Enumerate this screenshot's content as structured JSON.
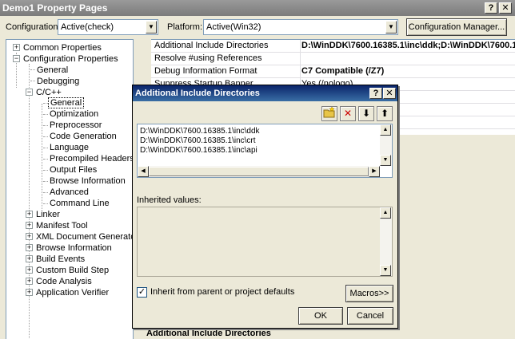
{
  "window": {
    "title": "Demo1 Property Pages",
    "help_glyph": "?",
    "close_glyph": "✕"
  },
  "toolbar": {
    "configuration_label": "Configuration:",
    "configuration_value": "Active(check)",
    "platform_label": "Platform:",
    "platform_value": "Active(Win32)",
    "config_manager_label": "Configuration Manager..."
  },
  "tree": {
    "common_properties": "Common Properties",
    "configuration_properties": "Configuration Properties",
    "general": "General",
    "debugging": "Debugging",
    "cpp": "C/C++",
    "cpp_children": [
      "General",
      "Optimization",
      "Preprocessor",
      "Code Generation",
      "Language",
      "Precompiled Headers",
      "Output Files",
      "Browse Information",
      "Advanced",
      "Command Line"
    ],
    "after_items": [
      "Linker",
      "Manifest Tool",
      "XML Document Generator",
      "Browse Information",
      "Build Events",
      "Custom Build Step",
      "Code Analysis",
      "Application Verifier"
    ]
  },
  "grid": {
    "rows": [
      {
        "name": "Additional Include Directories",
        "value": "D:\\WinDDK\\7600.16385.1\\inc\\ddk;D:\\WinDDK\\7600.1"
      },
      {
        "name": "Resolve #using References",
        "value": ""
      },
      {
        "name": "Debug Information Format",
        "value": "C7 Compatible (/Z7)"
      },
      {
        "name": "Suppress Startup Banner",
        "value": "Yes (/nologo)"
      }
    ],
    "bottom_label": "Additional Include Directories"
  },
  "dialog": {
    "title": "Additional Include Directories",
    "help_glyph": "?",
    "close_glyph": "✕",
    "directories": [
      "D:\\WinDDK\\7600.16385.1\\inc\\ddk",
      "D:\\WinDDK\\7600.16385.1\\inc\\crt",
      "D:\\WinDDK\\7600.16385.1\\inc\\api"
    ],
    "inherited_label": "Inherited values:",
    "inherit_checkbox_label": "Inherit from parent or project defaults",
    "inherit_checked": true,
    "macros_label": "Macros>>",
    "ok_label": "OK",
    "cancel_label": "Cancel"
  },
  "colors": {
    "dialog_title_bg": "#0a246a",
    "main_title_bg": "#7b7b7b",
    "face": "#ece9d8",
    "delete_red": "#cc0000"
  }
}
